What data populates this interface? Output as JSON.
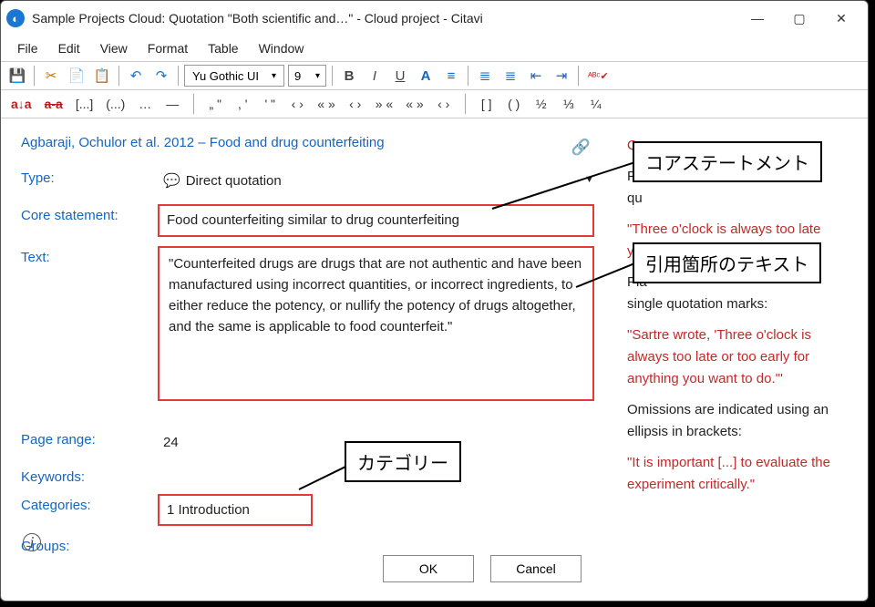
{
  "window": {
    "title": "Sample Projects Cloud: Quotation \"Both scientific and…\" - Cloud project - Citavi",
    "app_glyph": "◐",
    "controls": {
      "min": "—",
      "max": "▢",
      "close": "✕"
    }
  },
  "menu": [
    "File",
    "Edit",
    "View",
    "Format",
    "Table",
    "Window"
  ],
  "toolbar": {
    "font": "Yu Gothic UI",
    "size": "9",
    "bold": "B",
    "italic": "I",
    "underline": "U",
    "fontcolor": "A",
    "save": "💾",
    "cut": "✂",
    "copy": "📄",
    "paste": "📋",
    "undo": "↶",
    "redo": "↷",
    "align": "≡",
    "list_ul": "≣",
    "list_ol": "≣",
    "indent_dec": "⇤",
    "indent_inc": "⇥",
    "spellcheck": "ᴬᴮᶜ✔"
  },
  "symbols": {
    "row1_a": [
      "a↓a",
      "a-a",
      "[...]",
      "(...)",
      "…",
      "—"
    ],
    "row1_b": [
      "„ \"",
      ", '",
      "' \"",
      "‹ ›",
      "« »",
      "‹ ›",
      "» «",
      "« »",
      "‹ ›"
    ],
    "row1_c": [
      "[ ]",
      "( )",
      "½",
      "⅓",
      "¼"
    ]
  },
  "reference": "Agbaraji, Ochulor et al. 2012 – Food and drug counterfeiting",
  "fields": {
    "type_label": "Type:",
    "type_value": "Direct quotation",
    "core_label": "Core statement:",
    "core_value": "Food counterfeiting similar to drug counterfeiting",
    "text_label": "Text:",
    "text_value": "\"Counterfeited drugs are drugs that are not authentic and have been manufactured using incorrect quantities, or incorrect ingredients, to either reduce the potency, or nullify the potency of drugs altogether, and the same is applicable to food counterfeit.\"",
    "page_label": "Page range:",
    "page_value": "24",
    "keywords_label": "Keywords:",
    "categories_label": "Categories:",
    "categories_value": "1 Introduction",
    "groups_label": "Groups:"
  },
  "buttons": {
    "ok": "OK",
    "cancel": "Cancel"
  },
  "side": {
    "p1a": "Qu",
    "p2a": "Pla",
    "p2b": "qu",
    "p3": "\"Three o'clock is always too late",
    "p3b": "you",
    "p4a": "Pla",
    "p4": "single quotation marks:",
    "p5": "\"Sartre wrote, 'Three o'clock is always too late or too early for anything you want to do.'\"",
    "p6": "Omissions are indicated using an ellipsis in brackets:",
    "p7": "\"It is important [...] to evaluate the experiment critically.\""
  },
  "callouts": {
    "core": "コアステートメント",
    "text": "引用箇所のテキスト",
    "cat": "カテゴリー"
  },
  "icons": {
    "link": "🔗",
    "speech": "💬",
    "info": "i",
    "dd": "▼"
  }
}
